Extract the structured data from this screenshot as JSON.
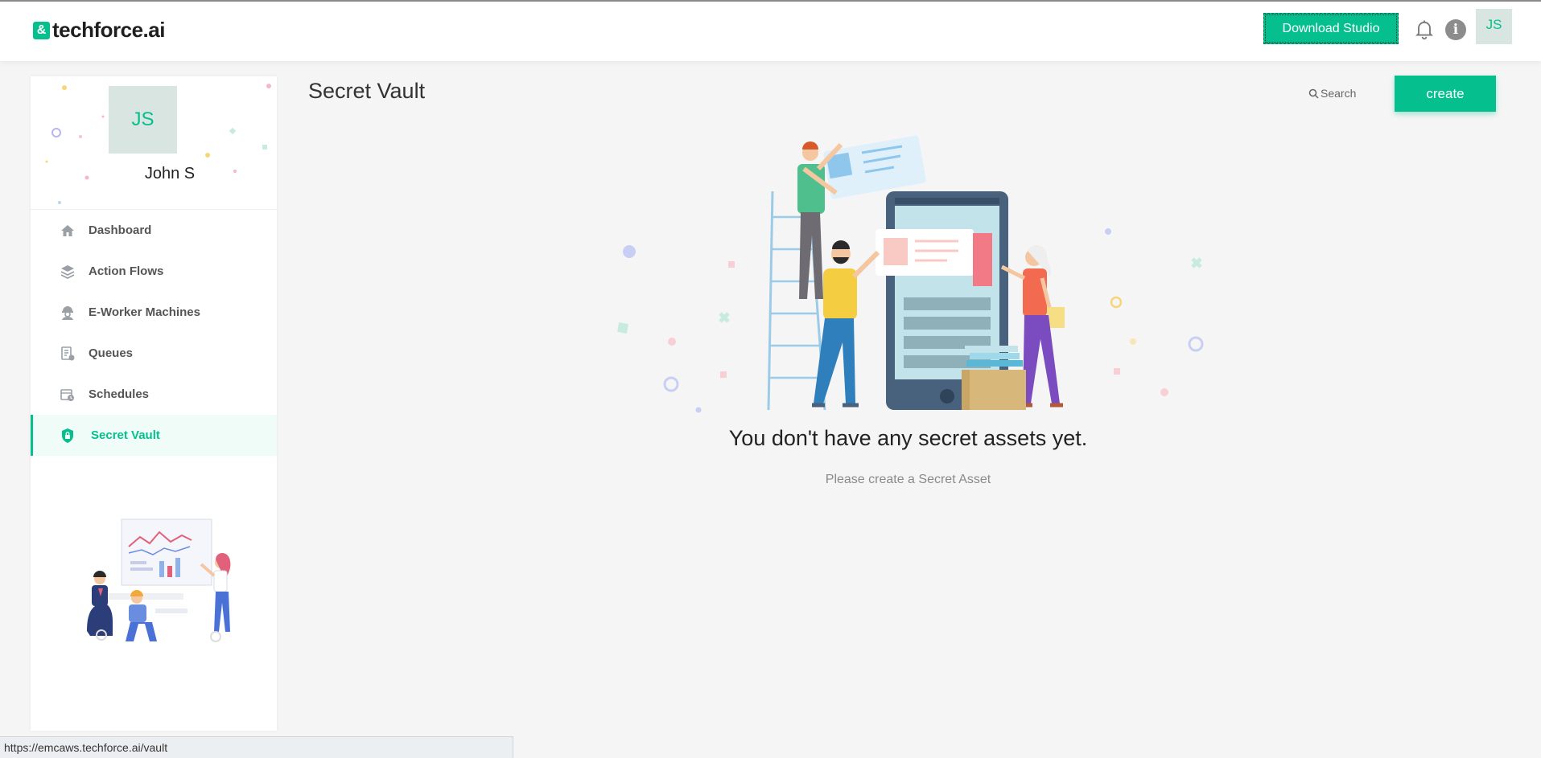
{
  "brand": {
    "mark": "&",
    "name": "techforce.ai"
  },
  "header": {
    "download_label": "Download Studio",
    "info_glyph": "i",
    "avatar_initials": "JS"
  },
  "profile": {
    "initials": "JS",
    "name": "John S"
  },
  "nav": {
    "items": [
      {
        "label": "Dashboard",
        "icon": "home-icon"
      },
      {
        "label": "Action Flows",
        "icon": "layers-icon"
      },
      {
        "label": "E-Worker Machines",
        "icon": "worker-icon"
      },
      {
        "label": "Queues",
        "icon": "queue-icon"
      },
      {
        "label": "Schedules",
        "icon": "schedule-icon"
      },
      {
        "label": "Secret Vault",
        "icon": "vault-shield-icon",
        "active": true
      }
    ]
  },
  "main": {
    "title": "Secret Vault",
    "search_label": "Search",
    "create_label": "create",
    "empty_title": "You don't have any secret assets yet.",
    "empty_subtitle": "Please create a Secret Asset"
  },
  "status": {
    "url": "https://emcaws.techforce.ai/vault"
  },
  "colors": {
    "accent": "#05c08e",
    "active_bg": "#f0fcf8",
    "page_bg": "#f5f5f5"
  }
}
